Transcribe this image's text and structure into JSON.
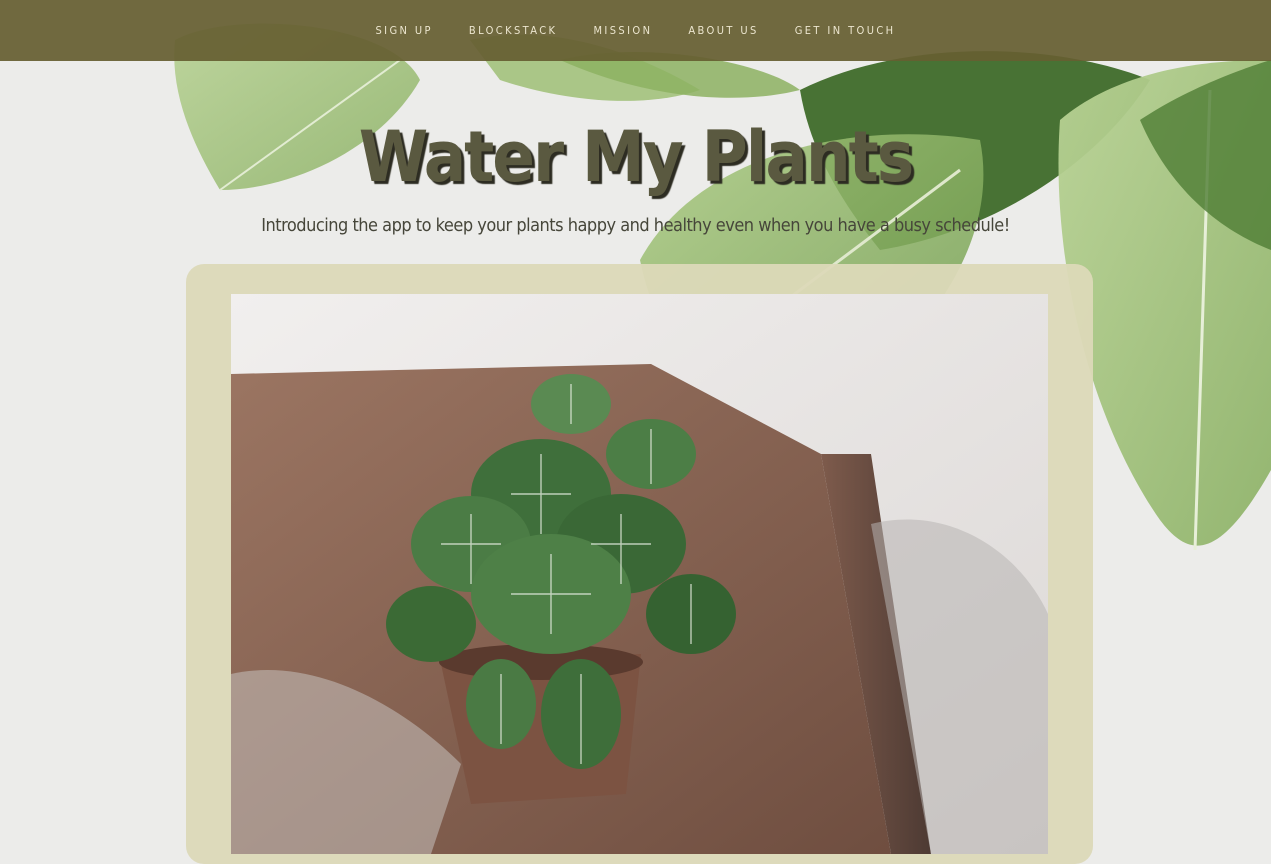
{
  "nav": {
    "items": [
      {
        "label": "SIGN UP"
      },
      {
        "label": "BLOCKSTACK"
      },
      {
        "label": "MISSION"
      },
      {
        "label": "ABOUT US"
      },
      {
        "label": "GET IN TOUCH"
      }
    ]
  },
  "hero": {
    "title": "Water My Plants",
    "subtitle": "Introducing the app to keep your plants happy and healthy even when you have a busy schedule!"
  },
  "colors": {
    "navbar": "#665f32",
    "background": "#ececea",
    "card": "#dcd9b8",
    "title": "#5a5940"
  },
  "images": {
    "background": "leaves",
    "card_photo": "potted-plant"
  }
}
